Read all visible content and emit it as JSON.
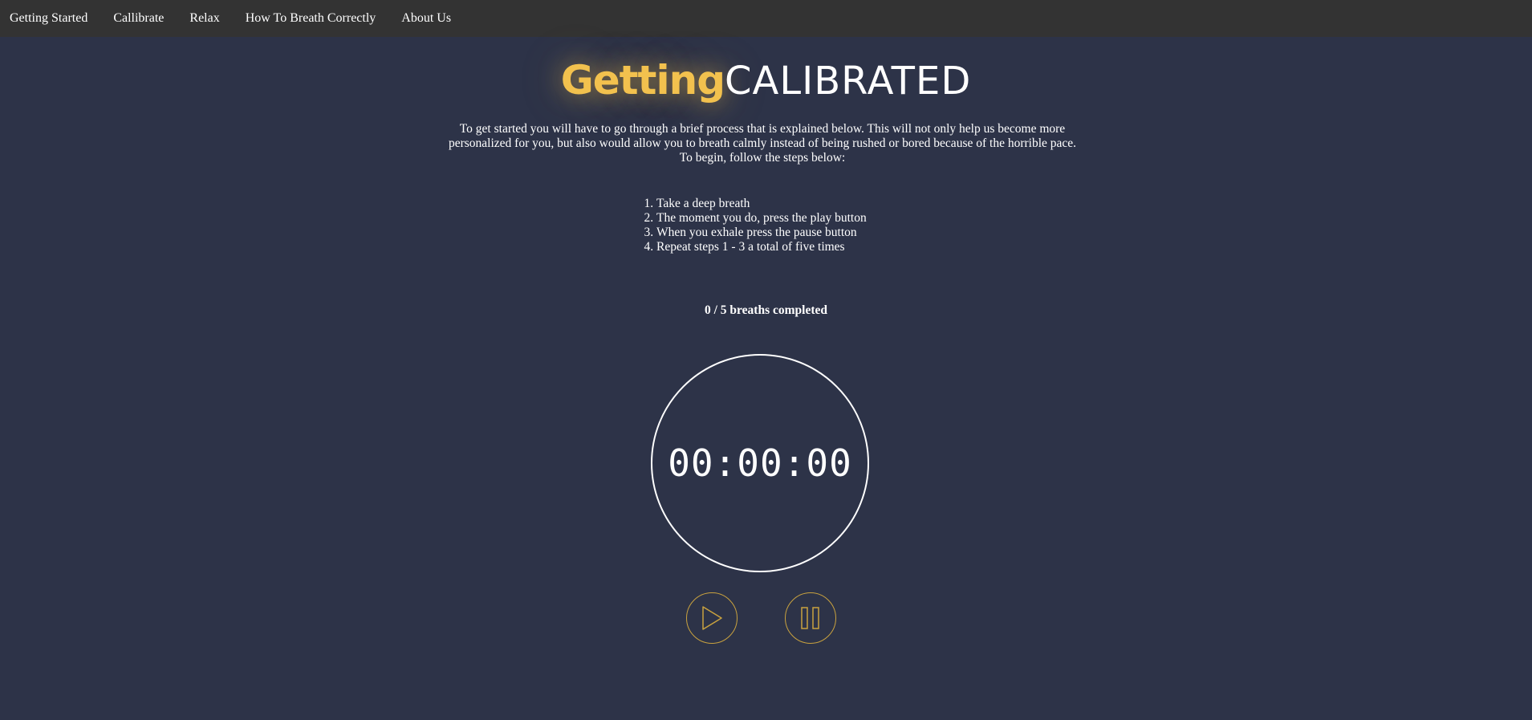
{
  "nav": {
    "items": [
      {
        "label": "Getting Started"
      },
      {
        "label": "Callibrate"
      },
      {
        "label": "Relax"
      },
      {
        "label": "How To Breath Correctly"
      },
      {
        "label": "About Us"
      }
    ]
  },
  "heading": {
    "bold": "Getting",
    "light": "CALIBRATED"
  },
  "intro": "To get started you will have to go through a brief process that is explained below. This will not only help us become more personalized for you, but also would allow you to breath calmly instead of being rushed or bored because of the horrible pace. To begin, follow the steps below:",
  "steps": [
    "Take a deep breath",
    "The moment you do, press the play button",
    "When you exhale press the pause button",
    "Repeat steps 1 - 3 a total of five times"
  ],
  "progress": "0 / 5 breaths completed",
  "timer": "00:00:00",
  "controls": {
    "play_icon": "play-icon",
    "pause_icon": "pause-icon"
  },
  "colors": {
    "background": "#2d3348",
    "navbar": "#333333",
    "accent": "#f2c14e",
    "button_border": "#c9a23f"
  }
}
